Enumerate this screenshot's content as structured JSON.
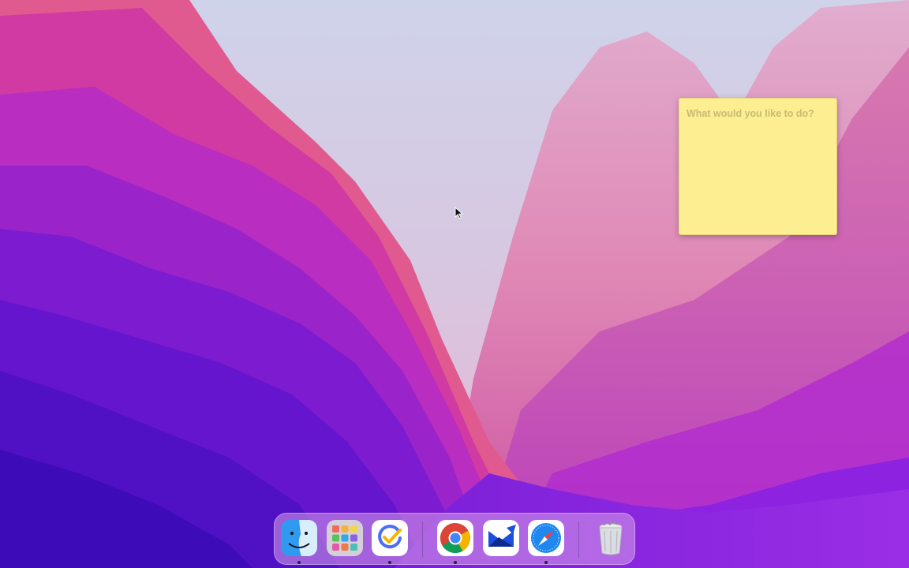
{
  "desktop": {
    "wallpaper_name": "macos-monterey-wallpaper"
  },
  "sticky_note": {
    "placeholder": "What would you like to do?",
    "color": "#fdee92"
  },
  "dock": {
    "apps": [
      {
        "name": "Finder",
        "icon": "finder-icon",
        "running": true
      },
      {
        "name": "Launchpad",
        "icon": "launchpad-icon",
        "running": false
      },
      {
        "name": "TickTick",
        "icon": "ticktick-icon",
        "running": true
      },
      {
        "name": "Google Chrome",
        "icon": "chrome-icon",
        "running": true
      },
      {
        "name": "Spark Mail",
        "icon": "spark-mail-icon",
        "running": false
      },
      {
        "name": "Safari",
        "icon": "safari-icon",
        "running": true
      }
    ],
    "trash": {
      "name": "Trash",
      "icon": "trash-icon"
    }
  }
}
